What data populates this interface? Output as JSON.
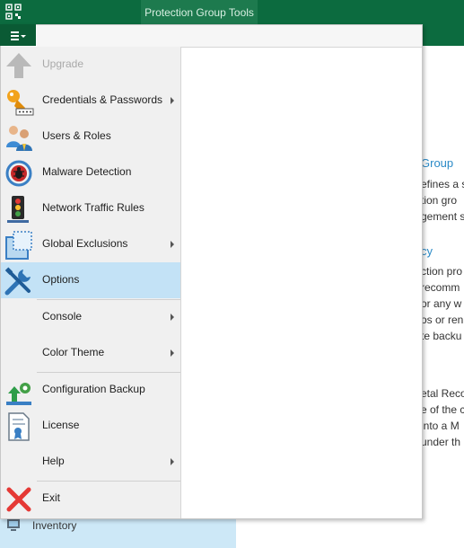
{
  "titlebar": {
    "contextual_tab": "Protection Group Tools"
  },
  "background": {
    "headings": [
      "Group",
      "cy"
    ],
    "lines_block1": [
      "efines a s",
      "tion gro",
      "gement s"
    ],
    "lines_block2": [
      "ction pro",
      "recomm",
      "or any w",
      "os or ren",
      "te backu"
    ],
    "lines_block3": [
      "etal Reco",
      "e of the c",
      "into a M",
      "under th"
    ]
  },
  "leftnav": {
    "inventory_label": "Inventory"
  },
  "menu": {
    "items": [
      {
        "label": "Upgrade",
        "icon": "upgrade-icon",
        "enabled": false,
        "submenu": false
      },
      {
        "label": "Credentials & Passwords",
        "icon": "key-icon",
        "enabled": true,
        "submenu": true
      },
      {
        "label": "Users & Roles",
        "icon": "users-icon",
        "enabled": true,
        "submenu": false
      },
      {
        "label": "Malware Detection",
        "icon": "bug-icon",
        "enabled": true,
        "submenu": false
      },
      {
        "label": "Network Traffic Rules",
        "icon": "traffic-light-icon",
        "enabled": true,
        "submenu": false
      },
      {
        "label": "Global Exclusions",
        "icon": "exclusions-icon",
        "enabled": true,
        "submenu": true
      },
      {
        "label": "Options",
        "icon": "tools-icon",
        "enabled": true,
        "submenu": false,
        "selected": true
      },
      {
        "label": "Console",
        "icon": "",
        "enabled": true,
        "submenu": true
      },
      {
        "label": "Color Theme",
        "icon": "",
        "enabled": true,
        "submenu": true
      },
      {
        "label": "Configuration Backup",
        "icon": "config-backup-icon",
        "enabled": true,
        "submenu": false
      },
      {
        "label": "License",
        "icon": "license-icon",
        "enabled": true,
        "submenu": false
      },
      {
        "label": "Help",
        "icon": "",
        "enabled": true,
        "submenu": true
      },
      {
        "label": "Exit",
        "icon": "exit-icon",
        "enabled": true,
        "submenu": false
      }
    ]
  },
  "colors": {
    "titlebar": "#0c6b3f",
    "selection": "#c3e2f6",
    "link_heading": "#2a8ac7"
  }
}
